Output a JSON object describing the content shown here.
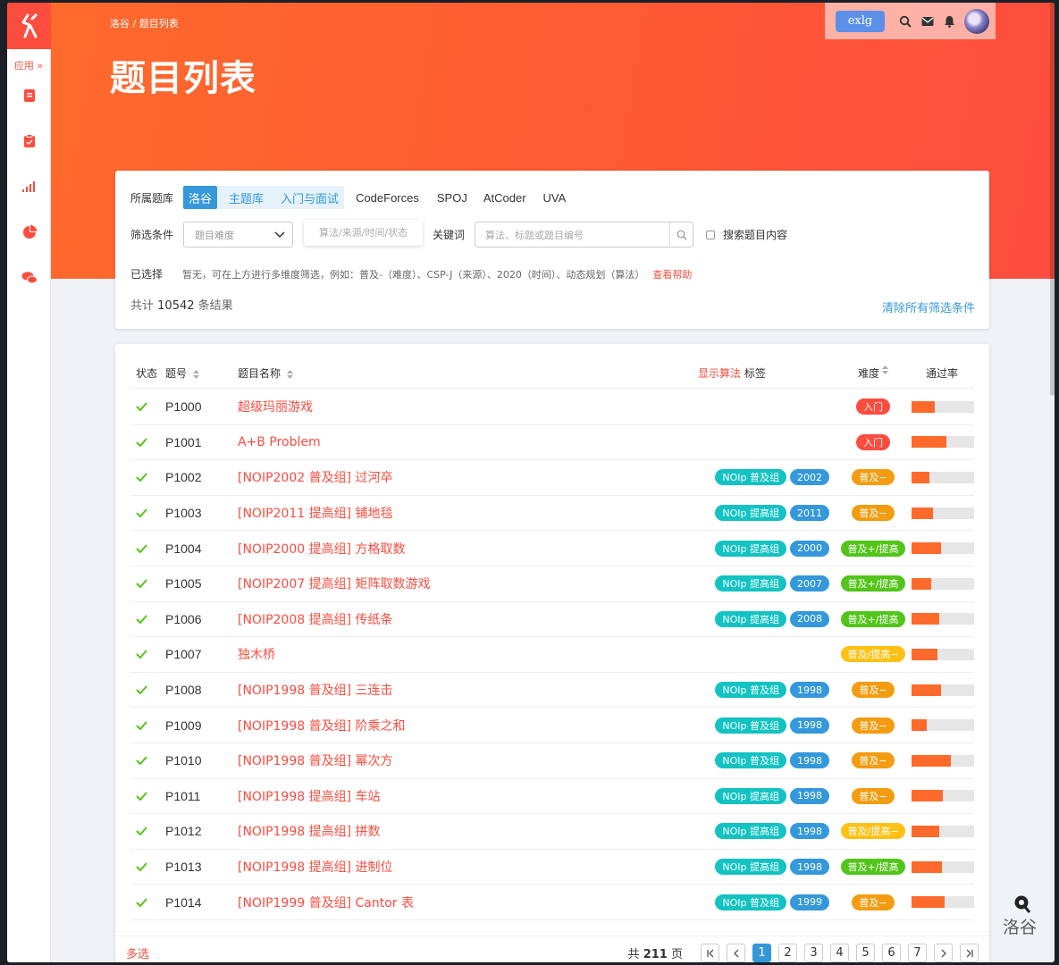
{
  "breadcrumb": "洛谷 / 题目列表",
  "page_title": "题目列表",
  "sidebar": {
    "apps_label": "应用 »"
  },
  "user": {
    "name": "exlg"
  },
  "filter": {
    "lib_label": "所属题库",
    "libraries": [
      "洛谷",
      "主题库",
      "入门与面试",
      "CodeForces",
      "SPOJ",
      "AtCoder",
      "UVA"
    ],
    "cond_label": "筛选条件",
    "difficulty_placeholder": "题目难度",
    "tag_placeholder": "算法/来源/时间/状态",
    "keyword_label": "关键词",
    "keyword_placeholder": "算法、标题或题目编号",
    "search_content_label": "搜索题目内容",
    "selected_label": "已选择",
    "selected_hint": "暂无，可在上方进行多维度筛选，例如：普及-（难度）、CSP-J（来源）、2020（时间）、动态规划（算法）",
    "help_link": "查看帮助",
    "total_prefix": "共计",
    "total_count": "10542",
    "total_suffix": "条结果",
    "clear_link": "清除所有筛选条件"
  },
  "table": {
    "headers": {
      "status": "状态",
      "pid": "题号",
      "title": "题目名称",
      "show_algo": "显示算法",
      "tags": "标签",
      "difficulty": "难度",
      "pass_rate": "通过率"
    },
    "rows": [
      {
        "pid": "P1000",
        "title": "超级玛丽游戏",
        "tags": [],
        "difficulty": "入门",
        "diff_color": "#fe4c3e",
        "rate": 0.37
      },
      {
        "pid": "P1001",
        "title": "A+B Problem",
        "tags": [],
        "difficulty": "入门",
        "diff_color": "#fe4c3e",
        "rate": 0.55
      },
      {
        "pid": "P1002",
        "title": "[NOIP2002 普及组] 过河卒",
        "tags": [
          "NOIp 普及组",
          "2002"
        ],
        "difficulty": "普及−",
        "diff_color": "#f39c11",
        "rate": 0.29
      },
      {
        "pid": "P1003",
        "title": "[NOIP2011 提高组] 铺地毯",
        "tags": [
          "NOIp 提高组",
          "2011"
        ],
        "difficulty": "普及−",
        "diff_color": "#f39c11",
        "rate": 0.34
      },
      {
        "pid": "P1004",
        "title": "[NOIP2000 提高组] 方格取数",
        "tags": [
          "NOIp 提高组",
          "2000"
        ],
        "difficulty": "普及+/提高",
        "diff_color": "#52c41a",
        "rate": 0.47
      },
      {
        "pid": "P1005",
        "title": "[NOIP2007 提高组] 矩阵取数游戏",
        "tags": [
          "NOIp 提高组",
          "2007"
        ],
        "difficulty": "普及+/提高",
        "diff_color": "#52c41a",
        "rate": 0.31
      },
      {
        "pid": "P1006",
        "title": "[NOIP2008 提高组] 传纸条",
        "tags": [
          "NOIp 提高组",
          "2008"
        ],
        "difficulty": "普及+/提高",
        "diff_color": "#52c41a",
        "rate": 0.44
      },
      {
        "pid": "P1007",
        "title": "独木桥",
        "tags": [],
        "difficulty": "普及/提高−",
        "diff_color": "#ffc116",
        "rate": 0.41
      },
      {
        "pid": "P1008",
        "title": "[NOIP1998 普及组] 三连击",
        "tags": [
          "NOIp 普及组",
          "1998"
        ],
        "difficulty": "普及−",
        "diff_color": "#f39c11",
        "rate": 0.47
      },
      {
        "pid": "P1009",
        "title": "[NOIP1998 普及组] 阶乘之和",
        "tags": [
          "NOIp 普及组",
          "1998"
        ],
        "difficulty": "普及−",
        "diff_color": "#f39c11",
        "rate": 0.24
      },
      {
        "pid": "P1010",
        "title": "[NOIP1998 普及组] 幂次方",
        "tags": [
          "NOIp 普及组",
          "1998"
        ],
        "difficulty": "普及−",
        "diff_color": "#f39c11",
        "rate": 0.63
      },
      {
        "pid": "P1011",
        "title": "[NOIP1998 提高组] 车站",
        "tags": [
          "NOIp 提高组",
          "1998"
        ],
        "difficulty": "普及−",
        "diff_color": "#f39c11",
        "rate": 0.5
      },
      {
        "pid": "P1012",
        "title": "[NOIP1998 提高组] 拼数",
        "tags": [
          "NOIp 提高组",
          "1998"
        ],
        "difficulty": "普及/提高−",
        "diff_color": "#ffc116",
        "rate": 0.44
      },
      {
        "pid": "P1013",
        "title": "[NOIP1998 提高组] 进制位",
        "tags": [
          "NOIp 提高组",
          "1998"
        ],
        "difficulty": "普及+/提高",
        "diff_color": "#52c41a",
        "rate": 0.49
      },
      {
        "pid": "P1014",
        "title": "[NOIP1999 普及组] Cantor 表",
        "tags": [
          "NOIp 普及组",
          "1999"
        ],
        "difficulty": "普及−",
        "diff_color": "#f39c11",
        "rate": 0.53
      }
    ]
  },
  "footer": {
    "multi_select": "多选",
    "pages_prefix": "共",
    "pages_total": "211",
    "pages_suffix": "页",
    "pages": [
      "1",
      "2",
      "3",
      "4",
      "5",
      "6",
      "7"
    ],
    "current_page": "1"
  },
  "fab": {
    "label": "洛谷"
  },
  "colors": {
    "accent": "#fe4c3e",
    "link": "#3498db",
    "accepted": "#52c41a"
  }
}
